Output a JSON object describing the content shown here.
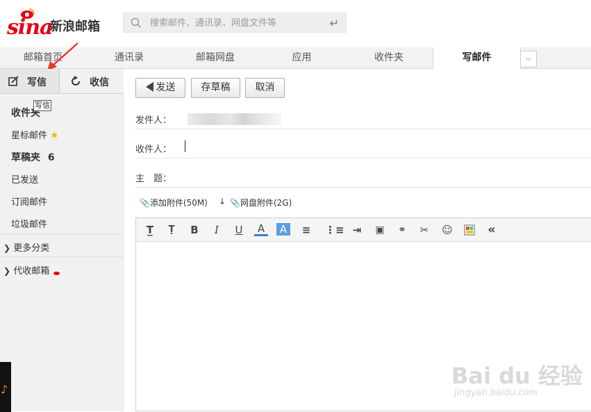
{
  "header": {
    "logo_text": "sina",
    "brand": "新浪邮箱",
    "search": {
      "placeholder": "搜索邮件、通讯录、网盘文件等",
      "enter_icon": "enter-icon"
    }
  },
  "nav": {
    "tabs": [
      {
        "label": "邮箱首页"
      },
      {
        "label": "通讯录"
      },
      {
        "label": "邮箱网盘"
      },
      {
        "label": "应用"
      },
      {
        "label": "收件夹"
      },
      {
        "label": "写邮件",
        "active": true
      }
    ],
    "more_icon": "chevron-down-icon"
  },
  "sidebar": {
    "write_label": "写信",
    "receive_label": "收信",
    "tooltip": "写信",
    "folders": [
      {
        "label": "收件夹",
        "bold": true
      },
      {
        "label": "星标邮件",
        "star": true
      },
      {
        "label": "草稿夹",
        "count": "6",
        "bold": true
      },
      {
        "label": "已发送"
      },
      {
        "label": "订阅邮件"
      },
      {
        "label": "垃圾邮件"
      }
    ],
    "more_label": "更多分类",
    "proxy_label": "代收邮箱"
  },
  "compose": {
    "send_label": "发送",
    "save_draft_label": "存草稿",
    "cancel_label": "取消",
    "from_label": "发件人：",
    "to_label": "收件人：",
    "subject_label": "主　题：",
    "attach_label": "添加附件(50M)",
    "cloud_attach_label": "网盘附件(2G)"
  },
  "watermark": {
    "main": "Bai du 经验",
    "sub": "jingyan.baidu.com"
  },
  "colors": {
    "brand_red": "#e60012",
    "accent_orange": "#f28c1a"
  }
}
